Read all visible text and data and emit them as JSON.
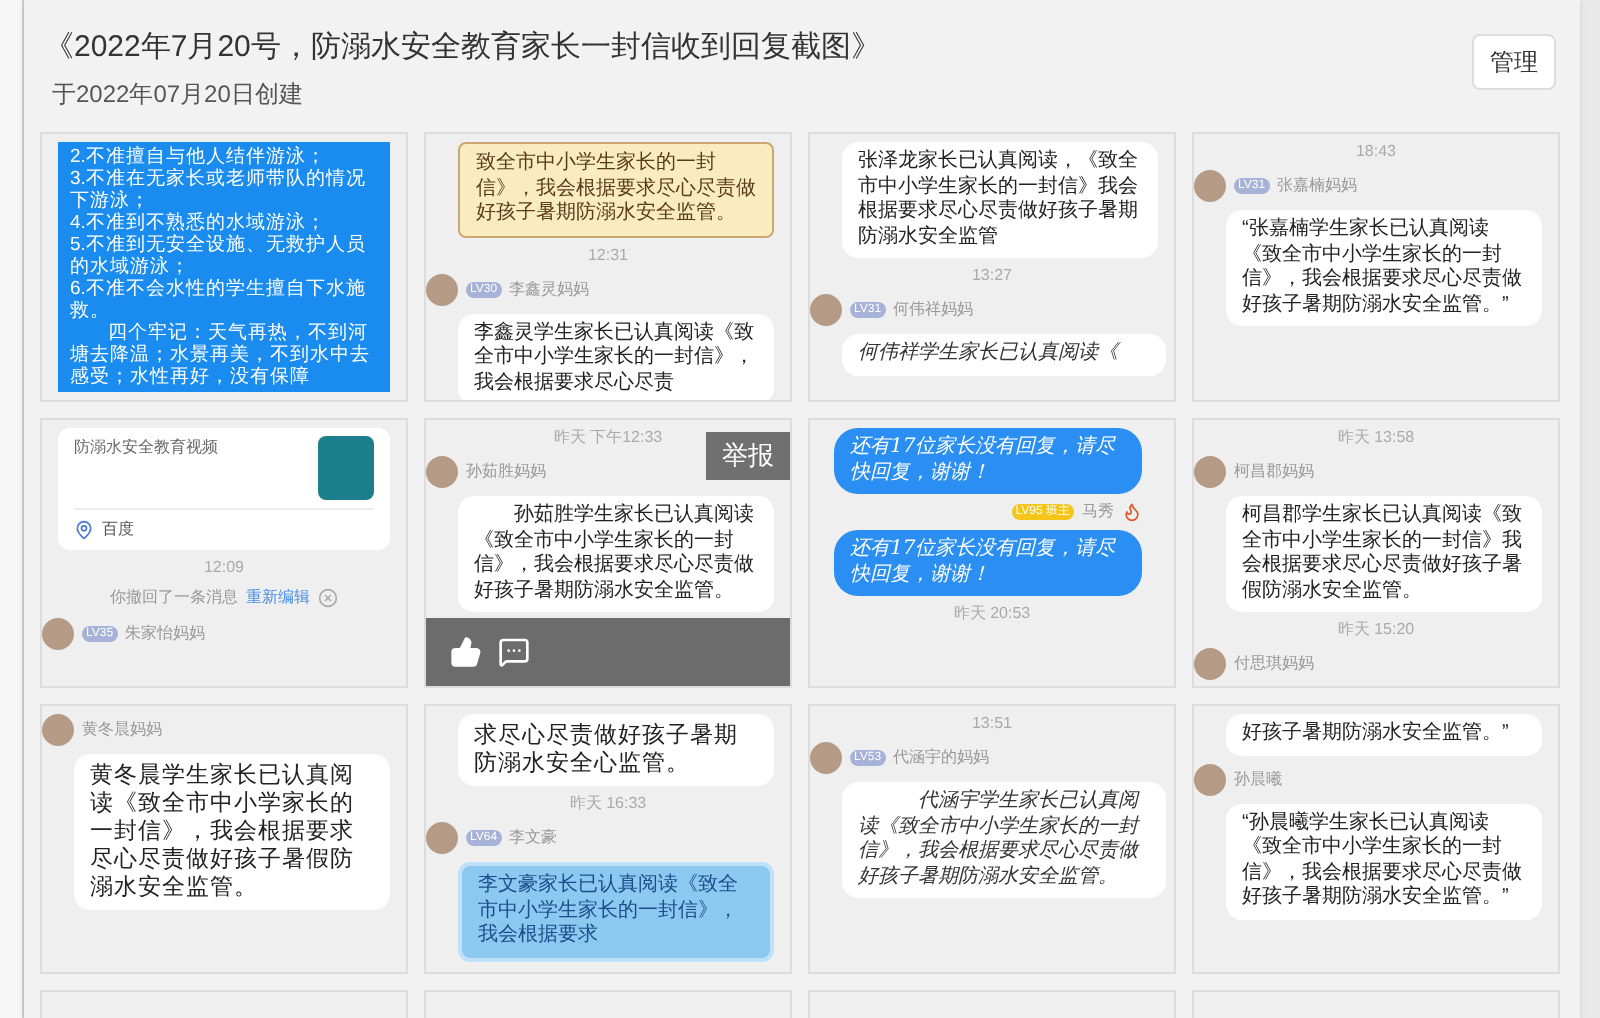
{
  "header": {
    "title": "《2022年7月20号，防溺水安全教育家长一封信收到回复截图》",
    "subtitle": "于2022年07月20日创建",
    "manage_button": "管理"
  },
  "tiles": [
    {
      "items": [
        {
          "kind": "blue_bubble",
          "lines": [
            "2.不准擅自与他人结伴游泳；",
            "3.不准在无家长或老师带队的情况下游泳；",
            "4.不准到不熟悉的水域游泳；",
            "5.不准到无安全设施、无救护人员的水域游泳；",
            "6.不准不会水性的学生擅自下水施救。",
            "四个牢记：天气再热，不到河塘去降温；水景再美，不到水中去感受；水性再好，没有保障"
          ]
        }
      ]
    },
    {
      "items": [
        {
          "kind": "paper_bubble",
          "text": "致全市中小学生家长的一封信》，我会根据要求尽心尽责做好孩子暑期防溺水安全监管。"
        },
        {
          "kind": "time",
          "text": "12:31"
        },
        {
          "kind": "sender",
          "badge": "LV30",
          "name": "李鑫灵妈妈"
        },
        {
          "kind": "bubble",
          "text": "李鑫灵学生家长已认真阅读《致全市中小学生家长的一封信》，我会根据要求尽心尽责"
        }
      ]
    },
    {
      "items": [
        {
          "kind": "bubble",
          "text": "张泽龙家长已认真阅读，《致全市中小学生家长的一封信》我会根据要求尽心尽责做好孩子暑期防溺水安全监管"
        },
        {
          "kind": "time",
          "text": "13:27"
        },
        {
          "kind": "sender",
          "badge": "LV31",
          "name": "何伟祥妈妈"
        },
        {
          "kind": "script_bubble",
          "text": "何伟祥学生家长已认真阅读《"
        }
      ]
    },
    {
      "items": [
        {
          "kind": "time",
          "text": "18:43"
        },
        {
          "kind": "sender",
          "badge": "LV31",
          "name": "张嘉楠妈妈"
        },
        {
          "kind": "bubble",
          "text": "“张嘉楠学生家长已认真阅读《致全市中小学生家长的一封信》，我会根据要求尽心尽责做好孩子暑期防溺水安全监管。”"
        }
      ]
    },
    {
      "items": [
        {
          "kind": "link_card",
          "title": "防溺水安全教育视频",
          "source": "百度"
        },
        {
          "kind": "time",
          "text": "12:09"
        },
        {
          "kind": "recall",
          "text": "你撤回了一条消息",
          "link": "重新编辑"
        },
        {
          "kind": "sender",
          "badge": "LV35",
          "name": "朱家怡妈妈"
        }
      ]
    },
    {
      "report_button": "举报",
      "actions_overlay": true,
      "items": [
        {
          "kind": "time",
          "text": "昨天 下午12:33"
        },
        {
          "kind": "sender",
          "name": "孙茹胜妈妈"
        },
        {
          "kind": "bubble",
          "text": "　　孙茹胜学生家长已认真阅读《致全市中小学生家长的一封信》，我会根据要求尽心尽责做好孩子暑期防溺水安全监管。"
        }
      ]
    },
    {
      "items": [
        {
          "kind": "own_bubble",
          "text": "还有17位家长没有回复，请尽快回复，谢谢！"
        },
        {
          "kind": "teacher_sender",
          "badge": "LV95 班主",
          "name": "马秀"
        },
        {
          "kind": "own_bubble",
          "text": "还有17位家长没有回复，请尽快回复，谢谢！"
        },
        {
          "kind": "time",
          "text": "昨天 20:53"
        }
      ]
    },
    {
      "items": [
        {
          "kind": "time",
          "text": "昨天 13:58"
        },
        {
          "kind": "sender",
          "name": "柯昌郡妈妈"
        },
        {
          "kind": "bubble",
          "text": "柯昌郡学生家长已认真阅读《致全市中小学生家长的一封信》我会根据要求尽心尽责做好孩子暑假防溺水安全监管。"
        },
        {
          "kind": "time",
          "text": "昨天 15:20"
        },
        {
          "kind": "sender",
          "name": "付思琪妈妈"
        }
      ]
    },
    {
      "items": [
        {
          "kind": "sender",
          "name": "黄冬晨妈妈"
        },
        {
          "kind": "large_bubble",
          "text": "黄冬晨学生家长已认真阅读《致全市中小学家长的一封信》，我会根据要求尽心尽责做好孩子暑假防溺水安全监管。"
        }
      ]
    },
    {
      "items": [
        {
          "kind": "large_bubble",
          "text": "求尽心尽责做好孩子暑期防溺水安全心监管。"
        },
        {
          "kind": "time",
          "text": "昨天 16:33"
        },
        {
          "kind": "sender",
          "badge": "LV64",
          "name": "李文豪"
        },
        {
          "kind": "light_blue_bubble",
          "text": "李文豪家长已认真阅读《致全市中小学生家长的一封信》，我会根据要求"
        }
      ]
    },
    {
      "items": [
        {
          "kind": "time",
          "text": "13:51"
        },
        {
          "kind": "sender",
          "badge": "LV53",
          "name": "代涵宇的妈妈"
        },
        {
          "kind": "script_bubble",
          "text": "　　　代涵宇学生家长已认真阅读《致全市中小学生家长的一封信》，我会根据要求尽心尽责做好孩子暑期防溺水安全监管。"
        }
      ]
    },
    {
      "items": [
        {
          "kind": "bubble",
          "text": "好孩子暑期防溺水安全监管。”"
        },
        {
          "kind": "sender",
          "name": "孙晨曦"
        },
        {
          "kind": "bubble",
          "text": "“孙晨曦学生家长已认真阅读《致全市中小学生家长的一封信》，我会根据要求尽心尽责做好孩子暑期防溺水安全监管。”"
        }
      ]
    }
  ]
}
